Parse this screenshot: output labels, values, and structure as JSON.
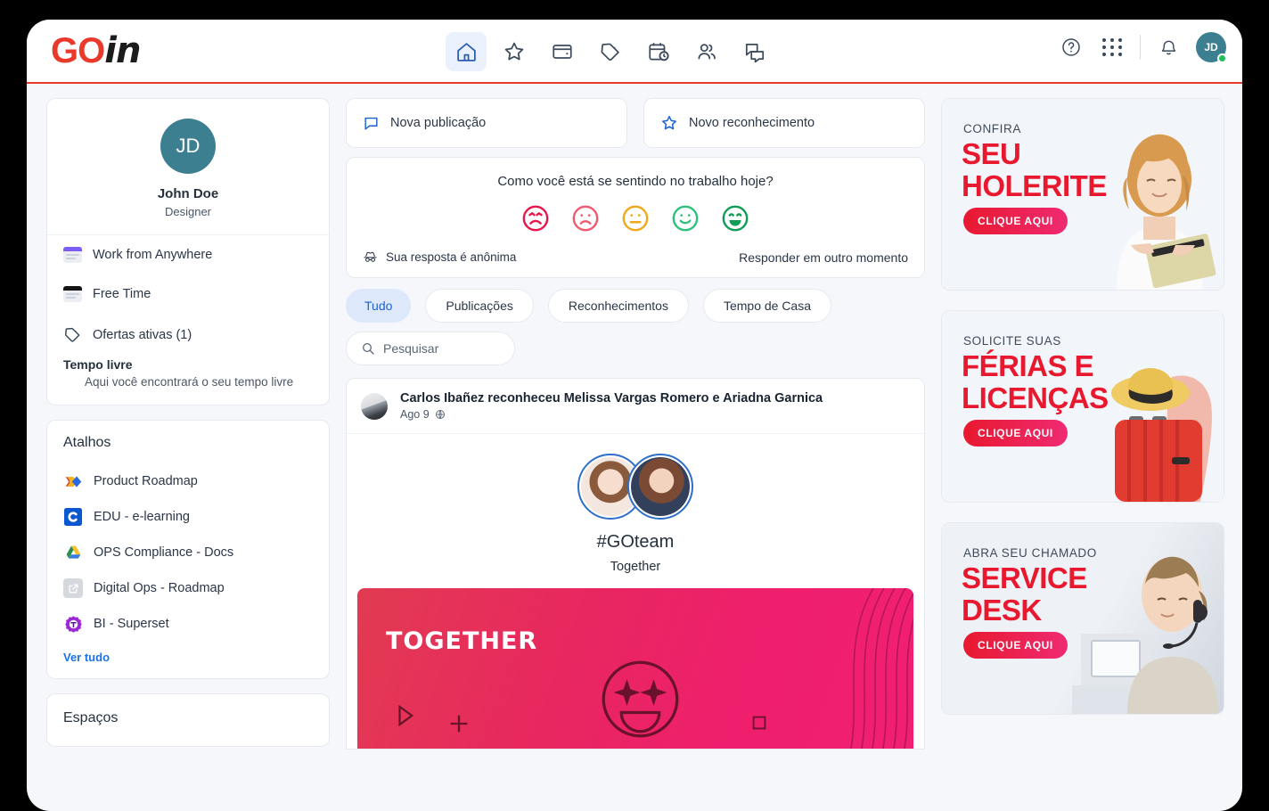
{
  "brand": {
    "go": "GO",
    "in": "in"
  },
  "header": {
    "nav": [
      {
        "name": "home-nav-icon",
        "label": "Início",
        "active": true
      },
      {
        "name": "star-nav-icon",
        "label": "Reconhecimentos",
        "active": false
      },
      {
        "name": "wallet-nav-icon",
        "label": "Carteira",
        "active": false
      },
      {
        "name": "tag-nav-icon",
        "label": "Ofertas",
        "active": false
      },
      {
        "name": "calendar-clock-nav-icon",
        "label": "Agenda",
        "active": false
      },
      {
        "name": "people-nav-icon",
        "label": "Pessoas",
        "active": false
      },
      {
        "name": "chat-nav-icon",
        "label": "Conversas",
        "active": false
      }
    ],
    "help_icon": "help-circle-icon",
    "apps_icon": "apps-grid-icon",
    "bell_icon": "bell-icon",
    "avatar_initials": "JD"
  },
  "sidebar": {
    "profile": {
      "initials": "JD",
      "name": "John Doe",
      "role": "Designer"
    },
    "statuses": [
      {
        "label": "Work from Anywhere",
        "color": "#7b5cf5",
        "icon": "document-icon"
      },
      {
        "label": "Free Time",
        "color": "#151515",
        "icon": "document-icon"
      },
      {
        "label": "Ofertas ativas (1)",
        "color": "",
        "icon": "tag-icon"
      }
    ],
    "tempo": {
      "title": "Tempo livre",
      "subtitle": "Aqui você encontrará o seu tempo livre"
    },
    "shortcuts": {
      "title": "Atalhos",
      "see_all": "Ver tudo",
      "items": [
        {
          "label": "Product Roadmap",
          "icon": "aha-icon"
        },
        {
          "label": "EDU - e-learning",
          "icon": "coursera-icon"
        },
        {
          "label": "OPS Compliance - Docs",
          "icon": "google-drive-icon"
        },
        {
          "label": "Digital Ops - Roadmap",
          "icon": "external-link-icon"
        },
        {
          "label": "BI - Superset",
          "icon": "superset-icon"
        }
      ]
    },
    "spaces": {
      "title": "Espaços"
    }
  },
  "feed": {
    "composers": [
      {
        "label": "Nova publicação",
        "icon": "speech-bubble-icon"
      },
      {
        "label": "Novo reconhecimento",
        "icon": "star-icon"
      }
    ],
    "mood": {
      "question": "Como você está se sentindo no trabalho hoje?",
      "options": [
        {
          "name": "mood-very-sad",
          "color": "#e8174b"
        },
        {
          "name": "mood-sad",
          "color": "#ef5a6e"
        },
        {
          "name": "mood-neutral",
          "color": "#f0a81b"
        },
        {
          "name": "mood-happy",
          "color": "#2fc07c"
        },
        {
          "name": "mood-very-happy",
          "color": "#0f9d58"
        }
      ],
      "anonymous_note": "Sua resposta é anônima",
      "later_label": "Responder em outro momento"
    },
    "filters": [
      {
        "label": "Tudo",
        "active": true
      },
      {
        "label": "Publicações",
        "active": false
      },
      {
        "label": "Reconhecimentos",
        "active": false
      },
      {
        "label": "Tempo de Casa",
        "active": false
      }
    ],
    "search": {
      "placeholder": "Pesquisar",
      "value": ""
    },
    "post": {
      "author_line": "Carlos Ibañez reconheceu Melissa Vargas Romero e Ariadna Garnica",
      "date": "Ago 9",
      "visibility_icon": "globe-icon",
      "hashtag": "#GOteam",
      "subtitle": "Together",
      "banner_title": "TOGETHER"
    }
  },
  "ads": [
    {
      "small": "CONFIRA",
      "big_line1": "SEU",
      "big_line2": "HOLERITE",
      "cta": "CLIQUE AQUI",
      "art": "woman-with-tablet"
    },
    {
      "small": "SOLICITE SUAS",
      "big_line1": "FÉRIAS E",
      "big_line2": "LICENÇAS",
      "cta": "CLIQUE AQUI",
      "art": "red-suitcase-and-hat"
    },
    {
      "small": "ABRA SEU CHAMADO",
      "big_line1": "SERVICE",
      "big_line2": "DESK",
      "cta": "CLIQUE AQUI",
      "art": "support-agent-with-headset"
    }
  ],
  "colors": {
    "brand_red": "#e8392b",
    "accent_blue": "#1a73e8",
    "teal_avatar": "#3b7f91",
    "ad_red": "#e8192f"
  }
}
